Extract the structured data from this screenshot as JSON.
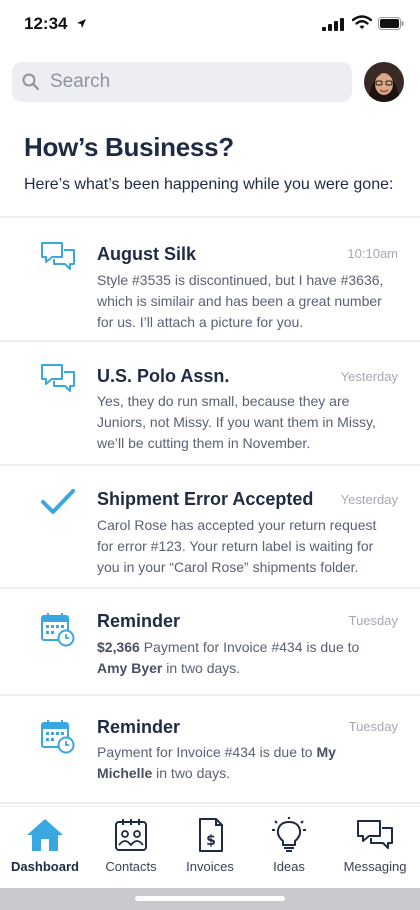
{
  "status_bar": {
    "time": "12:34"
  },
  "search": {
    "placeholder": "Search"
  },
  "header": {
    "title": "How’s Business?",
    "subtitle": "Here’s what’s been happening while you were gone:"
  },
  "feed": [
    {
      "icon": "chat-bubbles-icon",
      "title": "August Silk",
      "time": "10:10am",
      "body": "Style #3535 is discontinued, but I have #3636, which is similair and has been a great number for us.  I’ll attach a picture for you."
    },
    {
      "icon": "chat-bubbles-icon",
      "title": "U.S. Polo Assn.",
      "time": "Yesterday",
      "body": "Yes, they do run small, because they are Juniors, not Missy.  If you want them in Missy, we’ll be cutting them in November."
    },
    {
      "icon": "checkmark-icon",
      "title": "Shipment Error Accepted",
      "time": "Yesterday",
      "body": "Carol Rose  has accepted your return request for error #123.  Your return label is waiting for you in your “Carol Rose” shipments folder."
    },
    {
      "icon": "calendar-clock-icon",
      "title": "Reminder",
      "time": "Tuesday",
      "amount": "$2,366",
      "body_mid": " Payment for Invoice #434 is due to ",
      "name": "Amy Byer",
      "body_end": "  in two days."
    },
    {
      "icon": "calendar-clock-icon",
      "title": "Reminder",
      "time": "Tuesday",
      "body_start": "Payment for Invoice #434 is due to  ",
      "name": "My Michelle",
      "body_end": " in two days."
    }
  ],
  "tabs": [
    {
      "label": "Dashboard",
      "icon": "house-icon",
      "active": true
    },
    {
      "label": "Contacts",
      "icon": "contacts-icon",
      "active": false
    },
    {
      "label": "Invoices",
      "icon": "invoice-icon",
      "active": false
    },
    {
      "label": "Ideas",
      "icon": "lightbulb-icon",
      "active": false
    },
    {
      "label": "Messaging",
      "icon": "messaging-icon",
      "active": false
    }
  ],
  "colors": {
    "accent": "#3aa8e0",
    "title_text": "#1f2a44",
    "body_text": "#5b6175",
    "time_text": "#a5a9b3",
    "search_bg": "#eceef2"
  }
}
